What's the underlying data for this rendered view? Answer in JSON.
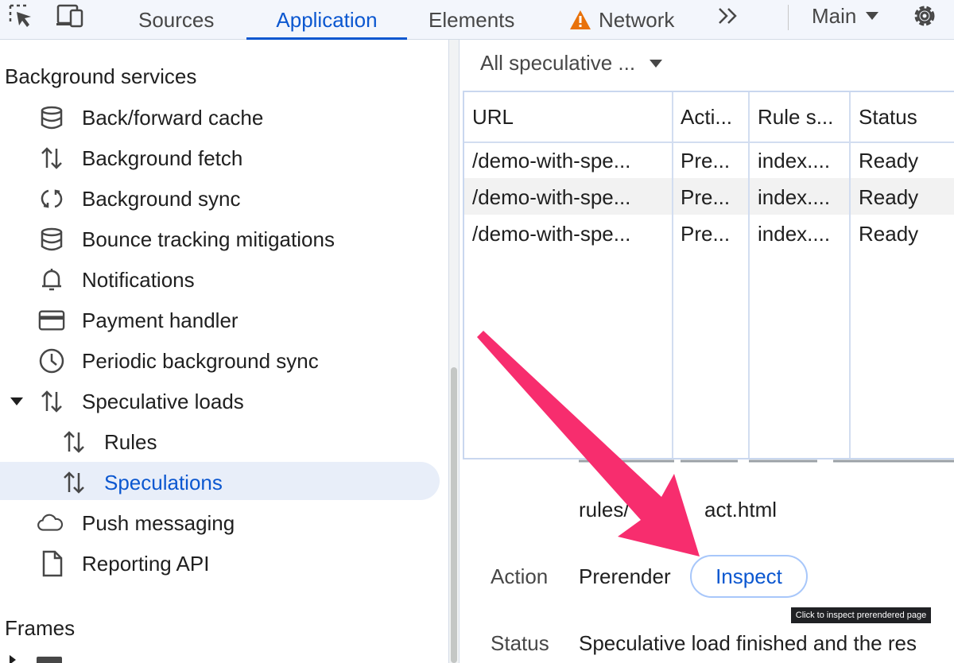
{
  "toolbar": {
    "tabs": [
      "Sources",
      "Application",
      "Elements",
      "Network"
    ],
    "more_icon": "chevron-double-right",
    "main_label": "Main",
    "warning_icon": "warning-triangle",
    "settings_icon": "gear",
    "colors": {
      "accent": "#0b57d0",
      "warning": "#e8710a"
    }
  },
  "sidebar": {
    "sections": [
      "Background services",
      "Frames"
    ],
    "items": [
      {
        "label": "Back/forward cache",
        "icon": "database"
      },
      {
        "label": "Background fetch",
        "icon": "up-down-arrows"
      },
      {
        "label": "Background sync",
        "icon": "sync"
      },
      {
        "label": "Bounce tracking mitigations",
        "icon": "database"
      },
      {
        "label": "Notifications",
        "icon": "bell"
      },
      {
        "label": "Payment handler",
        "icon": "credit-card"
      },
      {
        "label": "Periodic background sync",
        "icon": "clock"
      },
      {
        "label": "Speculative loads",
        "icon": "up-down-arrows",
        "expanded": true
      },
      {
        "label": "Rules",
        "icon": "up-down-arrows"
      },
      {
        "label": "Speculations",
        "icon": "up-down-arrows",
        "selected": true
      },
      {
        "label": "Push messaging",
        "icon": "cloud"
      },
      {
        "label": "Reporting API",
        "icon": "document"
      }
    ]
  },
  "main": {
    "filter_label": "All speculative ...",
    "table": {
      "headers": [
        "URL",
        "Acti...",
        "Rule s...",
        "Status"
      ],
      "rows": [
        [
          "/demo-with-spe...",
          "Pre...",
          "index....",
          "Ready"
        ],
        [
          "/demo-with-spe...",
          "Pre...",
          "index....",
          "Ready"
        ],
        [
          "/demo-with-spe...",
          "Pre...",
          "index....",
          "Ready"
        ]
      ]
    },
    "details": {
      "url_tail": "rules/",
      "url_end": "act.html",
      "action_label": "Action",
      "action_value": "Prerender",
      "inspect_button": "Inspect",
      "tooltip": "Click to inspect prerendered page",
      "status_label": "Status",
      "status_value": "Speculative load finished and the res"
    },
    "annotation": {
      "arrow_color": "#f72d6e"
    }
  }
}
